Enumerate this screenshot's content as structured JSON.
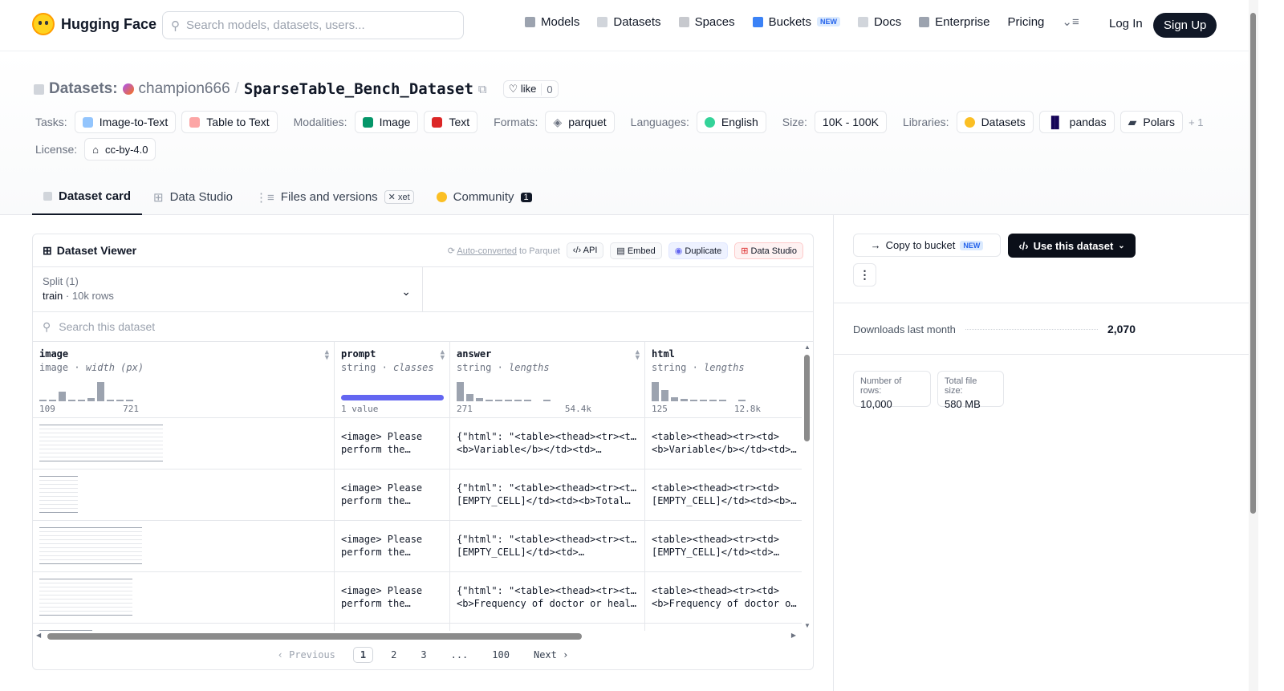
{
  "nav": {
    "brand": "Hugging Face",
    "search_placeholder": "Search models, datasets, users...",
    "links": [
      "Models",
      "Datasets",
      "Spaces",
      "Buckets",
      "Docs",
      "Enterprise",
      "Pricing"
    ],
    "new_badge": "NEW",
    "login": "Log In",
    "signup": "Sign Up"
  },
  "header": {
    "label": "Datasets:",
    "user": "champion666",
    "slash": "/",
    "repo": "SparseTable_Bench_Dataset",
    "like": "like",
    "like_count": "0",
    "tasks_label": "Tasks:",
    "tasks": [
      "Image-to-Text",
      "Table to Text"
    ],
    "modalities_label": "Modalities:",
    "modalities": [
      "Image",
      "Text"
    ],
    "formats_label": "Formats:",
    "formats": [
      "parquet"
    ],
    "languages_label": "Languages:",
    "languages": [
      "English"
    ],
    "size_label": "Size:",
    "size": "10K - 100K",
    "libraries_label": "Libraries:",
    "libraries": [
      "Datasets",
      "pandas",
      "Polars"
    ],
    "more_libraries": "+ 1",
    "license_label": "License:",
    "license": "cc-by-4.0"
  },
  "tabs": {
    "card": "Dataset card",
    "studio": "Data Studio",
    "files": "Files and versions",
    "xet": "xet",
    "community": "Community",
    "community_count": "1"
  },
  "viewer": {
    "title": "Dataset Viewer",
    "auto_converted": "Auto-converted",
    "to_parquet": "to Parquet",
    "api": "API",
    "embed": "Embed",
    "duplicate": "Duplicate",
    "data_studio": "Data Studio",
    "split_label": "Split (1)",
    "split_name": "train",
    "split_sep": "·",
    "split_rows": "10k rows",
    "search_placeholder": "Search this dataset",
    "columns": [
      {
        "name": "image",
        "type": "image",
        "stat": "width (px)",
        "min": "109",
        "max": "721"
      },
      {
        "name": "prompt",
        "type": "string",
        "stat": "classes",
        "min": "1 value",
        "max": ""
      },
      {
        "name": "answer",
        "type": "string",
        "stat": "lengths",
        "min": "271",
        "max": "54.4k"
      },
      {
        "name": "html",
        "type": "string",
        "stat": "lengths",
        "min": "125",
        "max": "12.8k"
      }
    ],
    "rows": [
      {
        "prompt1": "<image> Please",
        "prompt2": "perform the…",
        "answer1": "{\"html\": \"<table><thead><tr><td>",
        "answer2": "<b>Variable</b></td><td>…",
        "html1": "<table><thead><tr><td>",
        "html2": "<b>Variable</b></td><td>…"
      },
      {
        "prompt1": "<image> Please",
        "prompt2": "perform the…",
        "answer1": "{\"html\": \"<table><thead><tr><td>",
        "answer2": "[EMPTY_CELL]</td><td><b>Total…",
        "html1": "<table><thead><tr><td>",
        "html2": "[EMPTY_CELL]</td><td><b>Tot"
      },
      {
        "prompt1": "<image> Please",
        "prompt2": "perform the…",
        "answer1": "{\"html\": \"<table><thead><tr><td>",
        "answer2": "[EMPTY_CELL]</td><td>…",
        "html1": "<table><thead><tr><td>",
        "html2": "[EMPTY_CELL]</td><td>…"
      },
      {
        "prompt1": "<image> Please",
        "prompt2": "perform the…",
        "answer1": "{\"html\": \"<table><thead><tr><td>",
        "answer2": "<b>Frequency of doctor or healt…",
        "html1": "<table><thead><tr><td>",
        "html2": "<b>Frequency of doctor or h"
      }
    ],
    "pager": {
      "prev": "Previous",
      "pages": [
        "1",
        "2",
        "3",
        "...",
        "100"
      ],
      "next": "Next"
    }
  },
  "side": {
    "copy": "Copy to bucket",
    "new_badge": "NEW",
    "use": "Use this dataset",
    "downloads_label": "Downloads last month",
    "downloads": "2,070",
    "rows_label": "Number of rows:",
    "rows": "10,000",
    "size_label": "Total file size:",
    "size": "580 MB"
  },
  "colors": {
    "accent": "#6366f1",
    "dark": "#111827"
  }
}
